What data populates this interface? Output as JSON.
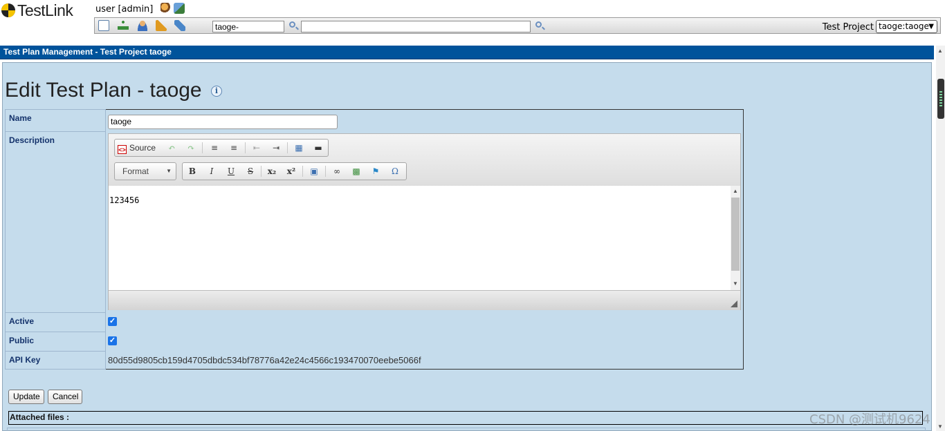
{
  "app": {
    "logo_text": "TestLink",
    "user_label": "user [admin]"
  },
  "toolbar": {
    "icons": [
      "home-icon",
      "sitemap-icon",
      "user-icon",
      "events-icon",
      "feather-icon"
    ],
    "search_tc_value": "taoge-",
    "search_all_value": "",
    "test_project_label": "Test Project",
    "test_project_selected": "taoge:taoge"
  },
  "title_bar": {
    "text": "Test Plan Management - Test Project taoge"
  },
  "main": {
    "page_title": "Edit Test Plan - taoge",
    "fields": {
      "name_label": "Name",
      "name_value": "taoge",
      "description_label": "Description",
      "active_label": "Active",
      "active_checked": true,
      "public_label": "Public",
      "public_checked": true,
      "api_key_label": "API Key",
      "api_key_value": "80d55d9805cb159d4705dbdc534bf78776a42e24c4566c193470070eebe5066f"
    },
    "editor": {
      "source_label": "Source",
      "format_label": "Format",
      "content": "123456"
    },
    "buttons": {
      "update": "Update",
      "cancel": "Cancel"
    },
    "attached_files_label": "Attached files :"
  },
  "watermark": "CSDN @测试机9624",
  "colors": {
    "title_bar": "#00539b",
    "workframe_bg": "#c5dcec",
    "label_text": "#14326b",
    "checkbox": "#1a73e8"
  }
}
